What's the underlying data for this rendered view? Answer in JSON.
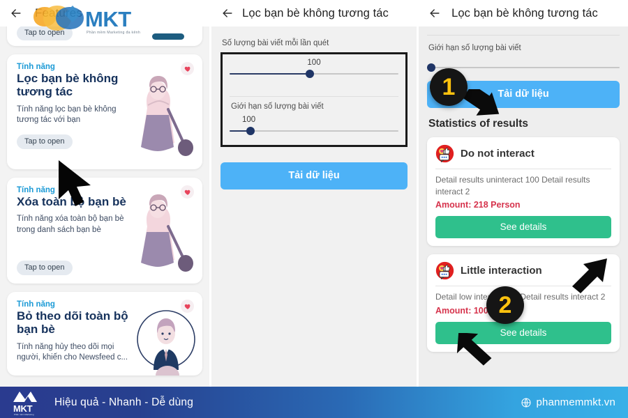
{
  "left_panel": {
    "appbar": {
      "back_icon": "back-arrow-icon",
      "title": "Features"
    },
    "clipped_card": {
      "tap_label": "Tap to open"
    },
    "cards": [
      {
        "eyebrow": "Tính năng",
        "title": "Lọc bạn bè không tương tác",
        "desc": "Tính năng lọc bạn bè không tương tác với bạn",
        "tap_label": "Tap to open",
        "fav_icon": "heart-icon",
        "art": "woman-illustration"
      },
      {
        "eyebrow": "Tính năng",
        "title": "Xóa toàn bộ bạn bè",
        "desc": "Tính năng xóa toàn bộ bạn bè trong danh sách bạn bè",
        "tap_label": "Tap to open",
        "fav_icon": "heart-icon",
        "art": "woman-illustration"
      },
      {
        "eyebrow": "Tính năng",
        "title": "Bỏ theo dõi toàn bộ bạn bè",
        "desc": "Tính năng hủy theo dõi mọi người, khiến cho Newsfeed c...",
        "tap_label": "",
        "fav_icon": "heart-icon",
        "art": "man-illustration"
      }
    ],
    "cursor_icon": "mouse-cursor-icon"
  },
  "mid_panel": {
    "appbar": {
      "back_icon": "back-arrow-icon",
      "title": "Lọc bạn bè không tương tác"
    },
    "field1_label": "Số lượng bài viết mỗi lần quét",
    "field1_value": "100",
    "field2_label": "Giới hạn số lượng bài viết",
    "field2_value": "100",
    "load_button": "Tải dữ liệu"
  },
  "right_panel": {
    "appbar": {
      "back_icon": "back-arrow-icon",
      "title": "Lọc bạn bè không tương tác"
    },
    "limit_label": "Giới hạn số lượng bài viết",
    "load_button": "Tải dữ liệu",
    "stats_title": "Statistics of results",
    "stat_cards": [
      {
        "icon": "reactions-icon",
        "name": "Do not interact",
        "detail": "Detail results uninteract 100 Detail results interact 2",
        "amount": "Amount: 218 Person",
        "button": "See details"
      },
      {
        "icon": "reactions-icon",
        "name": "Little interaction",
        "detail": "Detail low interact 100 Detail results interact 2",
        "amount": "Amount: 100 Person",
        "button": "See details"
      }
    ],
    "badges": [
      {
        "label": "1"
      },
      {
        "label": "2"
      }
    ],
    "arrow_icon": "black-arrow-icon"
  },
  "footer": {
    "logo": "mkt-logo",
    "slogan": "Hiệu quả - Nhanh  - Dễ dùng",
    "globe_icon": "globe-icon",
    "url": "phanmemmkt.vn"
  },
  "watermark": {
    "logo": "mkt-watermark-logo",
    "tagline": "Phần mềm Marketing đa kênh"
  },
  "colors": {
    "blue_button": "#4db2f7",
    "green_button": "#2fc08c",
    "amount_red": "#d6334c",
    "eyebrow_blue": "#1b9ad6",
    "card_title_navy": "#16325c",
    "badge_yellow": "#ffc20e",
    "slider_navy": "#1f3566"
  }
}
